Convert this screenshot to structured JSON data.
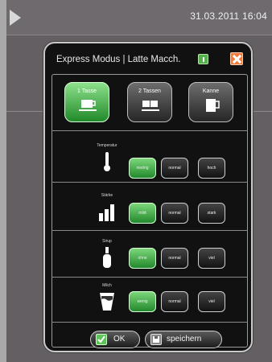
{
  "status_bar": {
    "datetime": "31.03.2011  16:04"
  },
  "dialog": {
    "title": "Express Modus | Latte Macch.",
    "cup_options": [
      {
        "label": "1 Tasse",
        "selected": true
      },
      {
        "label": "2 Tassen",
        "selected": false
      },
      {
        "label": "Kanne",
        "selected": false
      }
    ],
    "settings": [
      {
        "label": "Temperatur",
        "icon": "thermometer-icon",
        "options": [
          "niedrig",
          "normal",
          "hoch"
        ],
        "selected": "niedrig"
      },
      {
        "label": "Stärke",
        "icon": "strength-bars-icon",
        "options": [
          "mild",
          "normal",
          "stark"
        ],
        "selected": "mild"
      },
      {
        "label": "Sirup",
        "icon": "syrup-bottle-icon",
        "options": [
          "ohne",
          "normal",
          "viel"
        ],
        "selected": "ohne"
      },
      {
        "label": "Milch",
        "icon": "milk-glass-icon",
        "options": [
          "wenig",
          "normal",
          "viel"
        ],
        "selected": "wenig"
      }
    ],
    "buttons": {
      "ok": "OK",
      "save": "speichern"
    }
  },
  "colors": {
    "accent_green": "#2a9632",
    "close_orange": "#f27a3a"
  }
}
